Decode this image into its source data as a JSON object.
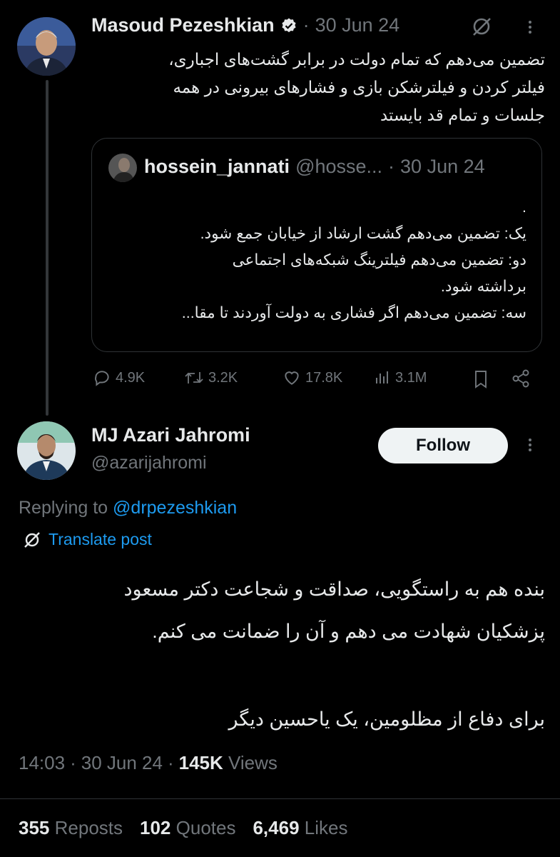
{
  "original_post": {
    "author_name": "Masoud Pezeshkian",
    "separator": "·",
    "date": "30 Jun 24",
    "text_lines": [
      "تضمین می‌دهم که تمام دولت در برابر گشت‌های اجباری،",
      "فیلتر کردن و فیلترشکن بازی و فشارهای بیرونی در همه",
      "جلسات و تمام قد بایستد"
    ],
    "quoted": {
      "author_name": "hossein_jannati",
      "handle": "@hosse...",
      "separator": "·",
      "date": "30 Jun 24",
      "text_lines": [
        ".",
        "یک: تضمین می‌دهم گشت ارشاد از خیابان جمع شود.",
        "دو: تضمین می‌دهم فیلترینگ شبکه‌های اجتماعی",
        "برداشته شود.",
        "سه: تضمین می‌دهم اگر فشاری به دولت آوردند تا مقا..."
      ]
    },
    "actions": {
      "replies": "4.9K",
      "reposts": "3.2K",
      "likes": "17.8K",
      "views": "3.1M"
    }
  },
  "reply_post": {
    "author_name": "MJ Azari Jahromi",
    "handle": "@azarijahromi",
    "follow_label": "Follow",
    "replying_to_label": "Replying to",
    "replying_to_handle": "@drpezeshkian",
    "translate_label": "Translate post",
    "text_lines": [
      "بنده هم به راستگویی، صداقت و شجاعت دکتر مسعود",
      "پزشکیان شهادت می دهم و آن را ضمانت می کنم.",
      "برای دفاع از مظلومین، یک یاحسین دیگر"
    ],
    "time": "14:03",
    "date": "30 Jun 24",
    "separator": "·",
    "views_count": "145K",
    "views_label": "Views",
    "stats": {
      "reposts_count": "355",
      "reposts_label": "Reposts",
      "quotes_count": "102",
      "quotes_label": "Quotes",
      "likes_count": "6,469",
      "likes_label": "Likes"
    }
  },
  "colors": {
    "background": "#000000",
    "text": "#e7e9ea",
    "muted": "#71767b",
    "link": "#1d9bf0",
    "border": "#2f3336",
    "verified": "#1d9bf0"
  }
}
